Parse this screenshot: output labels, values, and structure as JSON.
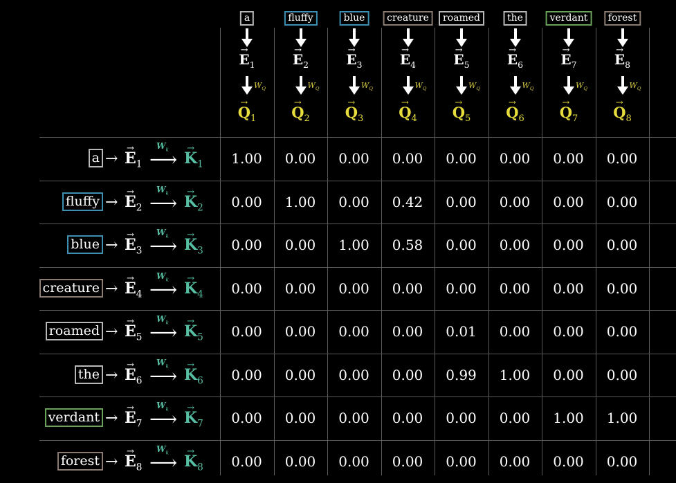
{
  "colors": {
    "background": "#000000",
    "query": "#e6dc3c",
    "key": "#56bfa3",
    "grid": "#5a5a5a"
  },
  "symbols": {
    "embedding": "E",
    "query": "Q",
    "key": "K",
    "wq": "W",
    "wq_sub": "Q",
    "wk": "W",
    "wk_sub": "k",
    "right_arrow": "→",
    "long_arrow": "⟶",
    "vector_arrow": "→"
  },
  "tokens": [
    {
      "word": "a",
      "index": "1",
      "border": "#b8b8b8"
    },
    {
      "word": "fluffy",
      "index": "2",
      "border": "#3f8fb0"
    },
    {
      "word": "blue",
      "index": "3",
      "border": "#3f8fb0"
    },
    {
      "word": "creature",
      "index": "4",
      "border": "#8a7c72"
    },
    {
      "word": "roamed",
      "index": "5",
      "border": "#b8b8b8"
    },
    {
      "word": "the",
      "index": "6",
      "border": "#b8b8b8"
    },
    {
      "word": "verdant",
      "index": "7",
      "border": "#6aa25c"
    },
    {
      "word": "forest",
      "index": "8",
      "border": "#8a7c72"
    }
  ],
  "matrix": [
    [
      "1.00",
      "0.00",
      "0.00",
      "0.00",
      "0.00",
      "0.00",
      "0.00",
      "0.00"
    ],
    [
      "0.00",
      "1.00",
      "0.00",
      "0.42",
      "0.00",
      "0.00",
      "0.00",
      "0.00"
    ],
    [
      "0.00",
      "0.00",
      "1.00",
      "0.58",
      "0.00",
      "0.00",
      "0.00",
      "0.00"
    ],
    [
      "0.00",
      "0.00",
      "0.00",
      "0.00",
      "0.00",
      "0.00",
      "0.00",
      "0.00"
    ],
    [
      "0.00",
      "0.00",
      "0.00",
      "0.00",
      "0.01",
      "0.00",
      "0.00",
      "0.00"
    ],
    [
      "0.00",
      "0.00",
      "0.00",
      "0.00",
      "0.99",
      "1.00",
      "0.00",
      "0.00"
    ],
    [
      "0.00",
      "0.00",
      "0.00",
      "0.00",
      "0.00",
      "0.00",
      "1.00",
      "1.00"
    ],
    [
      "0.00",
      "0.00",
      "0.00",
      "0.00",
      "0.00",
      "0.00",
      "0.00",
      "0.00"
    ]
  ]
}
